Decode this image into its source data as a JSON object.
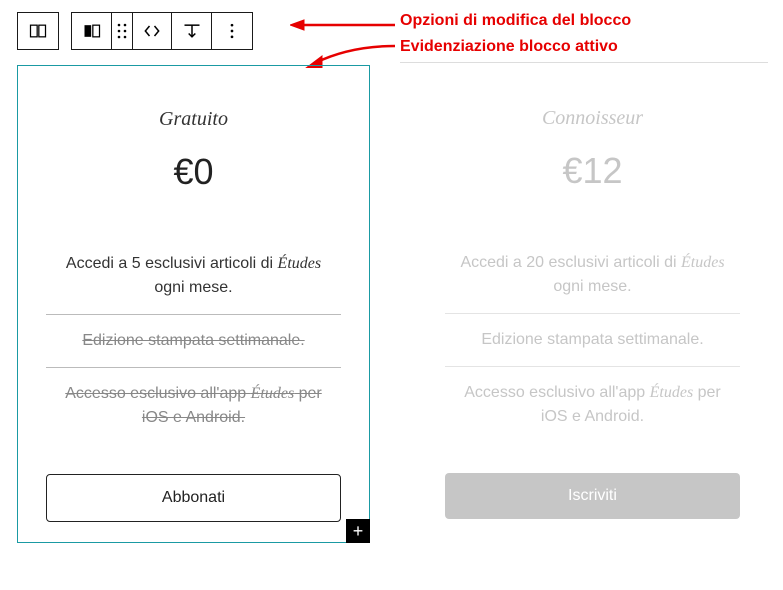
{
  "annotations": {
    "options": "Opzioni di modifica del blocco",
    "highlight": "Evidenziazione blocco attivo"
  },
  "toolbar": {
    "columns_icon": "columns-icon",
    "column_icon": "column-icon",
    "drag_icon": "drag-icon",
    "arrows_icon": "move-arrows-icon",
    "align_icon": "align-icon",
    "more_icon": "more-icon"
  },
  "plans": [
    {
      "name": "Gratuito",
      "price": "€0",
      "features": [
        {
          "pre": "Accedi a 5 esclusivi articoli di ",
          "em": "Études",
          "post": " ogni mese.",
          "strike": false
        },
        {
          "pre": "Edizione stampata settimanale.",
          "em": "",
          "post": "",
          "strike": true
        },
        {
          "pre": "Accesso esclusivo all'app ",
          "em": "Études",
          "post": " per iOS e Android.",
          "strike": true
        }
      ],
      "cta": "Abbonati",
      "active": true
    },
    {
      "name": "Connoisseur",
      "price": "€12",
      "features": [
        {
          "pre": "Accedi a 20 esclusivi articoli di ",
          "em": "Études",
          "post": " ogni mese.",
          "strike": false
        },
        {
          "pre": "Edizione stampata settimanale.",
          "em": "",
          "post": "",
          "strike": false
        },
        {
          "pre": "Accesso esclusivo all'app ",
          "em": "Études",
          "post": " per iOS e Android.",
          "strike": false
        }
      ],
      "cta": "Iscriviti",
      "active": false
    }
  ]
}
